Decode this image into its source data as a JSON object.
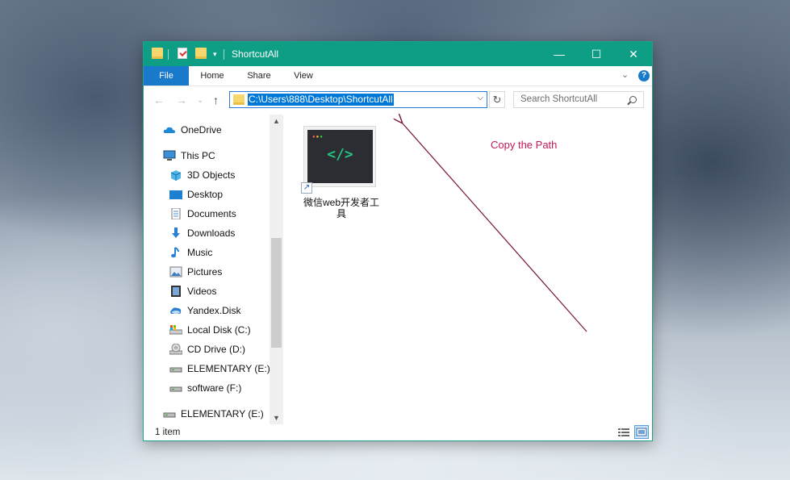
{
  "window": {
    "title": "ShortcutAll",
    "minimize_glyph": "—",
    "maximize_glyph": "☐",
    "close_glyph": "✕"
  },
  "ribbon": {
    "tabs": [
      "File",
      "Home",
      "Share",
      "View"
    ],
    "help_glyph": "?",
    "expand_glyph": "⌄"
  },
  "navigation": {
    "back_glyph": "←",
    "forward_glyph": "→",
    "recent_glyph": "⌄",
    "up_glyph": "↑",
    "address": "C:\\Users\\888\\Desktop\\ShortcutAll",
    "refresh_glyph": "↻",
    "search_placeholder": "Search ShortcutAll"
  },
  "sidebar": {
    "items": [
      {
        "label": "OneDrive",
        "icon": "onedrive-icon"
      },
      {
        "label": "This PC",
        "icon": "this-pc-icon"
      },
      {
        "label": "3D Objects",
        "icon": "3d-objects-icon"
      },
      {
        "label": "Desktop",
        "icon": "desktop-icon"
      },
      {
        "label": "Documents",
        "icon": "documents-icon"
      },
      {
        "label": "Downloads",
        "icon": "downloads-icon"
      },
      {
        "label": "Music",
        "icon": "music-icon"
      },
      {
        "label": "Pictures",
        "icon": "pictures-icon"
      },
      {
        "label": "Videos",
        "icon": "videos-icon"
      },
      {
        "label": "Yandex.Disk",
        "icon": "yandex-disk-icon"
      },
      {
        "label": "Local Disk (C:)",
        "icon": "local-disk-icon"
      },
      {
        "label": "CD Drive (D:)",
        "icon": "cd-drive-icon"
      },
      {
        "label": "ELEMENTARY (E:)",
        "icon": "usb-drive-icon"
      },
      {
        "label": "software (F:)",
        "icon": "usb-drive-icon"
      },
      {
        "label": "ELEMENTARY (E:)",
        "icon": "usb-drive-icon"
      }
    ]
  },
  "files": [
    {
      "name": "微信web开发者工具",
      "icon": "devtools-shortcut-icon",
      "thumb_code": "</>"
    }
  ],
  "status": {
    "item_count": "1 item"
  },
  "annotation": {
    "text": "Copy the Path",
    "color": "#c2185b"
  },
  "colors": {
    "titlebar": "#0e9e85",
    "file_tab": "#1979ca",
    "selection": "#0078d7"
  }
}
